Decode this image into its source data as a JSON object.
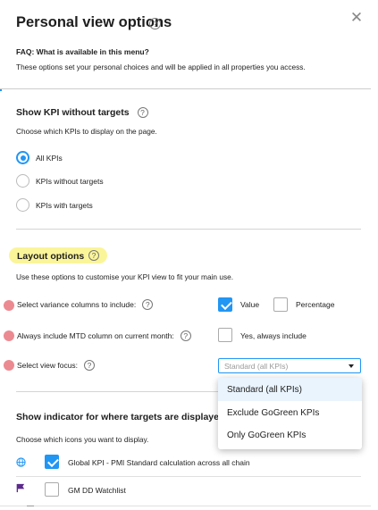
{
  "dialog": {
    "title": "Personal view options",
    "faq": "FAQ: What is available in this menu?",
    "intro": "These options set your personal choices and will be applied in all properties you access."
  },
  "kpi_section": {
    "heading": "Show KPI without targets",
    "subtitle": "Choose which KPIs to display on the page.",
    "options": [
      {
        "label": "All KPIs",
        "selected": true
      },
      {
        "label": "KPIs without targets",
        "selected": false
      },
      {
        "label": "KPIs with targets",
        "selected": false
      }
    ]
  },
  "layout_section": {
    "heading": "Layout options",
    "subtitle": "Use these options to customise your KPI view to fit your main use.",
    "variance_label": "Select variance columns to include:",
    "value_label": "Value",
    "value_checked": true,
    "percentage_label": "Percentage",
    "percentage_checked": false,
    "mtd_label": "Always include MTD column on current month:",
    "mtd_option_label": "Yes, always include",
    "mtd_checked": false,
    "focus_label": "Select view focus:",
    "focus_placeholder": "Standard (all KPIs)",
    "focus_options": [
      "Standard (all KPIs)",
      "Exclude GoGreen KPIs",
      "Only GoGreen KPIs"
    ]
  },
  "indicator_section": {
    "heading": "Show indicator for where targets are displayed",
    "subtitle": "Choose which icons you want to display.",
    "items": [
      {
        "icon": "globe-icon",
        "label": "Global KPI - PMI Standard calculation across all chain",
        "checked": true
      },
      {
        "icon": "flag-icon",
        "label": "GM DD Watchlist",
        "checked": false
      }
    ]
  },
  "colors": {
    "accent": "#2196f3",
    "highlight": "#fbf59a",
    "marker": "#ec8a91",
    "flag": "#5c2a8c"
  }
}
